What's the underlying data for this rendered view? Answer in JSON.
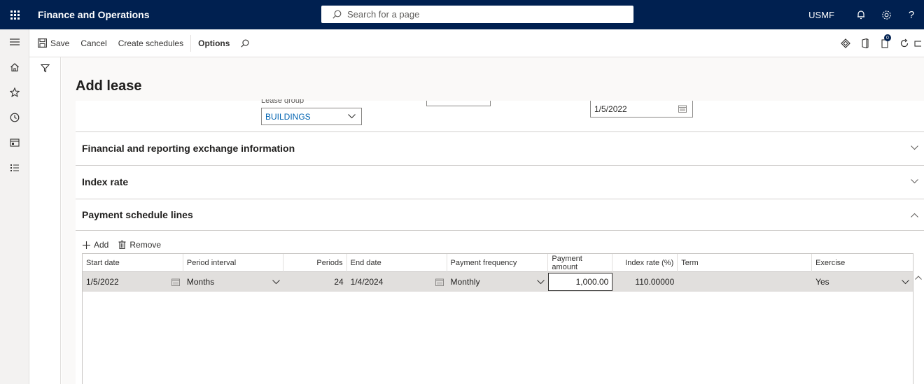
{
  "topbar": {
    "app_title": "Finance and Operations",
    "search_placeholder": "Search for a page",
    "company": "USMF"
  },
  "action_pane": {
    "save": "Save",
    "cancel": "Cancel",
    "create_schedules": "Create schedules",
    "options": "Options",
    "notification_count": "0"
  },
  "page": {
    "title": "Add lease"
  },
  "form": {
    "lease_group_label": "Lease group",
    "lease_group_value": "BUILDINGS",
    "date_value": "1/5/2022"
  },
  "sections": {
    "financial": "Financial and reporting exchange information",
    "index_rate": "Index rate",
    "payment_schedule": "Payment schedule lines"
  },
  "grid_toolbar": {
    "add": "Add",
    "remove": "Remove"
  },
  "grid": {
    "columns": {
      "start_date": "Start date",
      "period_interval": "Period interval",
      "periods": "Periods",
      "end_date": "End date",
      "payment_frequency": "Payment frequency",
      "payment_amount": "Payment amount",
      "index_rate": "Index rate (%)",
      "term": "Term",
      "exercise": "Exercise"
    },
    "rows": [
      {
        "start_date": "1/5/2022",
        "period_interval": "Months",
        "periods": "24",
        "end_date": "1/4/2024",
        "payment_frequency": "Monthly",
        "payment_amount": "1,000.00",
        "index_rate": "110.00000",
        "term": "",
        "exercise": "Yes"
      }
    ]
  },
  "colors": {
    "topbar": "#002050",
    "link": "#0063b1",
    "row_selected": "#e1dfdd"
  }
}
